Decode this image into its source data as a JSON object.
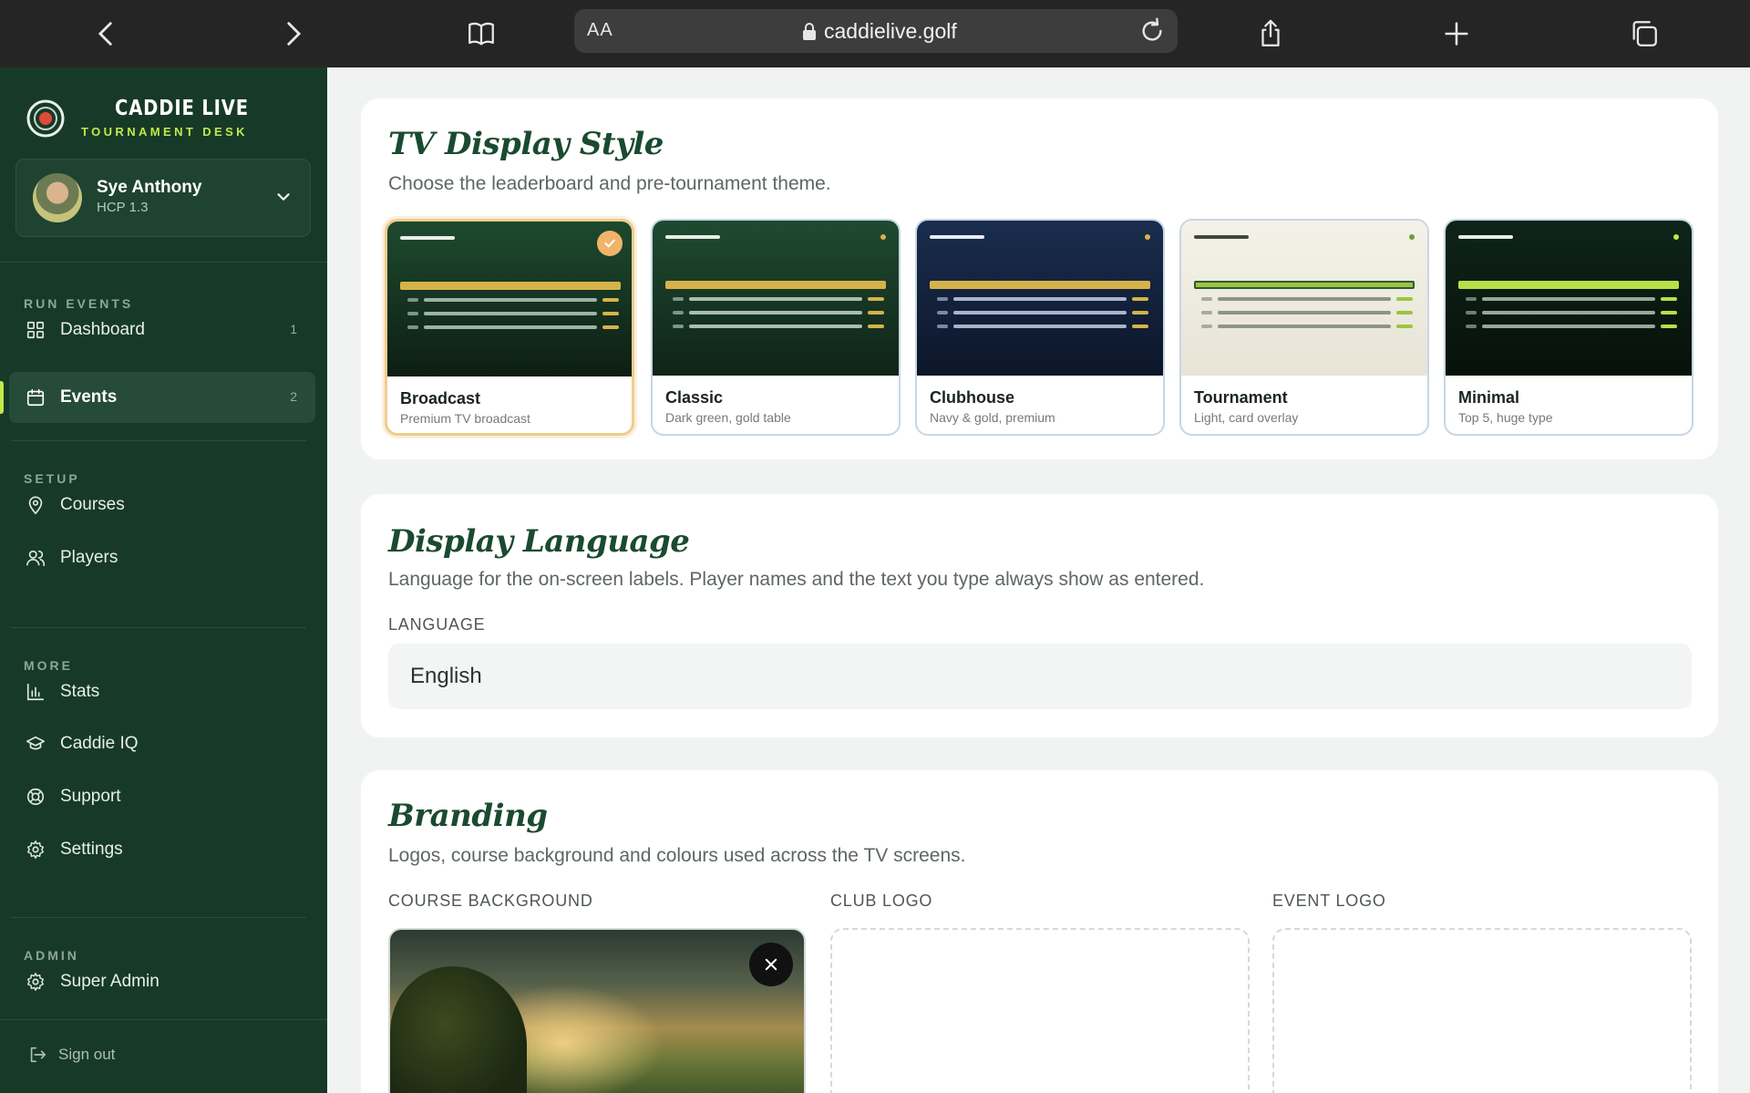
{
  "browser": {
    "aa_label": "AA",
    "url": "caddielive.golf"
  },
  "sidebar": {
    "brand_title": "CADDIE LIVE",
    "brand_subtitle": "TOURNAMENT DESK",
    "user": {
      "name": "Sye Anthony",
      "hcp": "HCP 1.3"
    },
    "sections": {
      "run_events": "RUN EVENTS",
      "setup": "SETUP",
      "more": "MORE",
      "admin": "ADMIN"
    },
    "items": {
      "dashboard": {
        "label": "Dashboard",
        "count": "1"
      },
      "events": {
        "label": "Events",
        "count": "2"
      },
      "courses": {
        "label": "Courses"
      },
      "players": {
        "label": "Players"
      },
      "stats": {
        "label": "Stats"
      },
      "caddie_iq": {
        "label": "Caddie IQ"
      },
      "support": {
        "label": "Support"
      },
      "settings": {
        "label": "Settings"
      },
      "super_admin": {
        "label": "Super Admin"
      }
    },
    "sign_out": "Sign out",
    "accent_color": "#c2e84a"
  },
  "tv_display": {
    "title": "TV Display Style",
    "description": "Choose the leaderboard and pre-tournament theme.",
    "selected": "broadcast",
    "themes": [
      {
        "id": "broadcast",
        "name": "Broadcast",
        "desc": "Premium TV broadcast"
      },
      {
        "id": "classic",
        "name": "Classic",
        "desc": "Dark green, gold table"
      },
      {
        "id": "clubhouse",
        "name": "Clubhouse",
        "desc": "Navy & gold, premium"
      },
      {
        "id": "tournament",
        "name": "Tournament",
        "desc": "Light, card overlay"
      },
      {
        "id": "minimal",
        "name": "Minimal",
        "desc": "Top 5, huge type"
      }
    ]
  },
  "display_language": {
    "title": "Display Language",
    "description": "Language for the on-screen labels. Player names and the text you type always show as entered.",
    "field_label": "LANGUAGE",
    "value": "English"
  },
  "branding": {
    "title": "Branding",
    "description": "Logos, course background and colours used across the TV screens.",
    "course_background_label": "COURSE BACKGROUND",
    "club_logo_label": "CLUB LOGO",
    "event_logo_label": "EVENT LOGO"
  }
}
